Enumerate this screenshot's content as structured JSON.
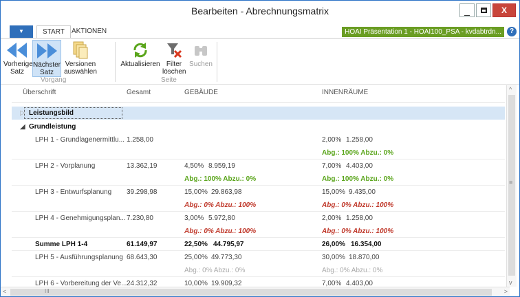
{
  "window": {
    "title": "Bearbeiten - Abrechnungsmatrix"
  },
  "tabs": {
    "file": "▼",
    "start": "START",
    "actions": "AKTIONEN"
  },
  "context": {
    "label": "HOAI Präsentation 1 - HOAI100_PSA - kvdabtrdn...",
    "help": "?"
  },
  "ribbon": {
    "prev": "Vorheriger\nSatz",
    "next": "Nächster\nSatz",
    "versions": "Versionen\nauswählen",
    "group1": "Vorgang",
    "refresh": "Aktualisieren",
    "filter": "Filter\nlöschen",
    "search": "Suchen",
    "group2": "Seite"
  },
  "columns": {
    "c1": "Überschrift",
    "c2": "Gesamt",
    "c3": "GEBÄUDE",
    "c4": "INNENRÄUME"
  },
  "groups": {
    "g1": "Leistungsbild",
    "g2": "Grundleistung"
  },
  "rows": [
    {
      "name": "LPH 1 - Grundlagenermittlu...",
      "total": "1.258,00",
      "gp": "",
      "gv": "",
      "ip": "2,00%",
      "iv": "1.258,00"
    },
    {
      "name": "LPH 2 - Vorplanung",
      "total": "13.362,19",
      "gp": "4,50%",
      "gv": "8.959,19",
      "ip": "7,00%",
      "iv": "4.403,00"
    },
    {
      "name": "LPH 3 - Entwurfsplanung",
      "total": "39.298,98",
      "gp": "15,00%",
      "gv": "29.863,98",
      "ip": "15,00%",
      "iv": "9.435,00"
    },
    {
      "name": "LPH 4 - Genehmigungsplan...",
      "total": "7.230,80",
      "gp": "3,00%",
      "gv": "5.972,80",
      "ip": "2,00%",
      "iv": "1.258,00"
    },
    {
      "name": "Summe LPH 1-4",
      "total": "61.149,97",
      "gp": "22,50%",
      "gv": "44.795,97",
      "ip": "26,00%",
      "iv": "16.354,00"
    },
    {
      "name": "LPH 5 - Ausführungsplanung",
      "total": "68.643,30",
      "gp": "25,00%",
      "gv": "49.773,30",
      "ip": "30,00%",
      "iv": "18.870,00"
    },
    {
      "name": "LPH 6 - Vorbereitung der Ve...",
      "total": "24.312,32",
      "gp": "10,00%",
      "gv": "19.909,32",
      "ip": "7,00%",
      "iv": "4.403,00"
    }
  ],
  "status": {
    "ok": "Abg.: 100%  Abzu.: 0%",
    "bad": "Abg.: 0%  Abzu.: 100%",
    "neutral": "Abg.: 0%  Abzu.: 0%"
  },
  "scroll": {
    "left": "<",
    "right": ">",
    "up": "^",
    "down": "v",
    "grip": "III",
    "mid": "≡"
  },
  "colors": {
    "accent": "#2f6fba",
    "ok": "#5aa51b",
    "bad": "#c0392b",
    "selection": "#d6e6f6",
    "context": "#6a9d23"
  }
}
